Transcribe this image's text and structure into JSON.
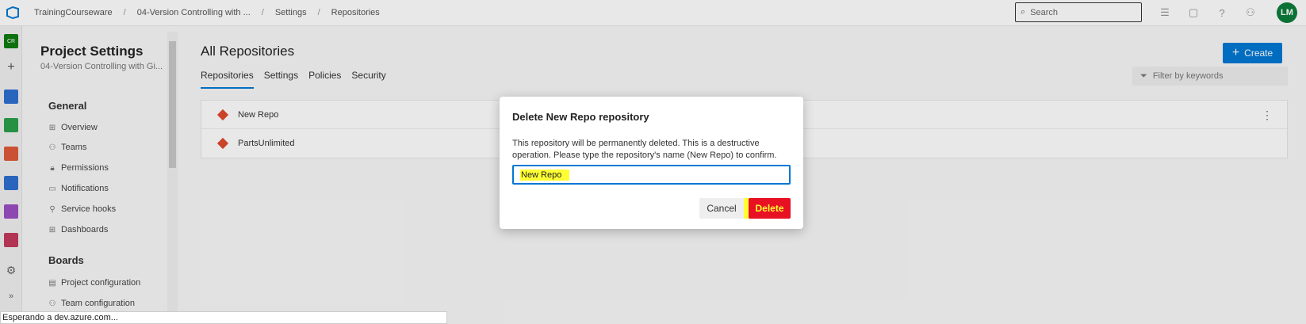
{
  "topbar": {
    "breadcrumbs": [
      "TrainingCourseware",
      "04-Version Controlling with ...",
      "Settings",
      "Repositories"
    ],
    "search_placeholder": "Search",
    "avatar_initials": "LM"
  },
  "rail": {
    "project_badge": "CR"
  },
  "sidebar": {
    "title": "Project Settings",
    "subtitle": "04-Version Controlling with Gi...",
    "sections": [
      {
        "title": "General",
        "items": [
          "Overview",
          "Teams",
          "Permissions",
          "Notifications",
          "Service hooks",
          "Dashboards"
        ]
      },
      {
        "title": "Boards",
        "items": [
          "Project configuration",
          "Team configuration"
        ]
      }
    ]
  },
  "main": {
    "title": "All Repositories",
    "tabs": [
      "Repositories",
      "Settings",
      "Policies",
      "Security"
    ],
    "create_label": "Create",
    "filter_placeholder": "Filter by keywords",
    "repos": [
      "New Repo",
      "PartsUnlimited"
    ]
  },
  "dialog": {
    "title": "Delete New Repo repository",
    "body": "This repository will be permanently deleted. This is a destructive operation. Please type the repository's name (New Repo) to confirm.",
    "input_value": "New Repo",
    "cancel_label": "Cancel",
    "delete_label": "Delete"
  },
  "statusbar": {
    "text": "Esperando a dev.azure.com..."
  },
  "colors": {
    "accent": "#0078d4",
    "danger": "#e81123",
    "highlight": "#ffff33",
    "avatar": "#0d7d3a"
  }
}
